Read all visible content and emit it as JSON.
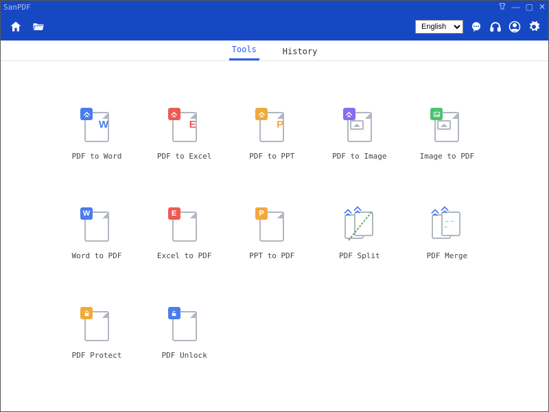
{
  "titlebar": {
    "app_name": "SanPDF"
  },
  "header": {
    "language_selected": "English",
    "language_options": [
      "English"
    ]
  },
  "tabs": {
    "tools": "Tools",
    "history": "History",
    "active": "tools"
  },
  "tools": [
    {
      "id": "pdf-to-word",
      "label": "PDF to Word",
      "badge_color": "blue",
      "badge_letter": "",
      "page_letter": "W",
      "page_letter_color": "blue",
      "icon_type": "letter"
    },
    {
      "id": "pdf-to-excel",
      "label": "PDF to Excel",
      "badge_color": "red",
      "badge_letter": "",
      "page_letter": "E",
      "page_letter_color": "red",
      "icon_type": "letter"
    },
    {
      "id": "pdf-to-ppt",
      "label": "PDF to PPT",
      "badge_color": "orange",
      "badge_letter": "",
      "page_letter": "P",
      "page_letter_color": "orange",
      "icon_type": "letter"
    },
    {
      "id": "pdf-to-image",
      "label": "PDF to Image",
      "badge_color": "purple",
      "badge_letter": "",
      "icon_type": "image"
    },
    {
      "id": "image-to-pdf",
      "label": "Image to PDF",
      "badge_color": "green",
      "badge_letter": "",
      "icon_type": "image"
    },
    {
      "id": "word-to-pdf",
      "label": "Word to PDF",
      "badge_color": "blue",
      "badge_letter": "W",
      "icon_type": "pdfmark"
    },
    {
      "id": "excel-to-pdf",
      "label": "Excel to PDF",
      "badge_color": "red",
      "badge_letter": "E",
      "icon_type": "pdfmark"
    },
    {
      "id": "ppt-to-pdf",
      "label": "PPT to PDF",
      "badge_color": "orange",
      "badge_letter": "P",
      "icon_type": "pdfmark"
    },
    {
      "id": "pdf-split",
      "label": "PDF Split",
      "icon_type": "split"
    },
    {
      "id": "pdf-merge",
      "label": "PDF Merge",
      "icon_type": "merge"
    },
    {
      "id": "pdf-protect",
      "label": "PDF Protect",
      "badge_color": "orange",
      "badge_letter": "",
      "badge_icon": "lock",
      "icon_type": "pdfmark"
    },
    {
      "id": "pdf-unlock",
      "label": "PDF Unlock",
      "badge_color": "blue",
      "badge_letter": "",
      "badge_icon": "unlock",
      "icon_type": "pdfmark"
    }
  ]
}
